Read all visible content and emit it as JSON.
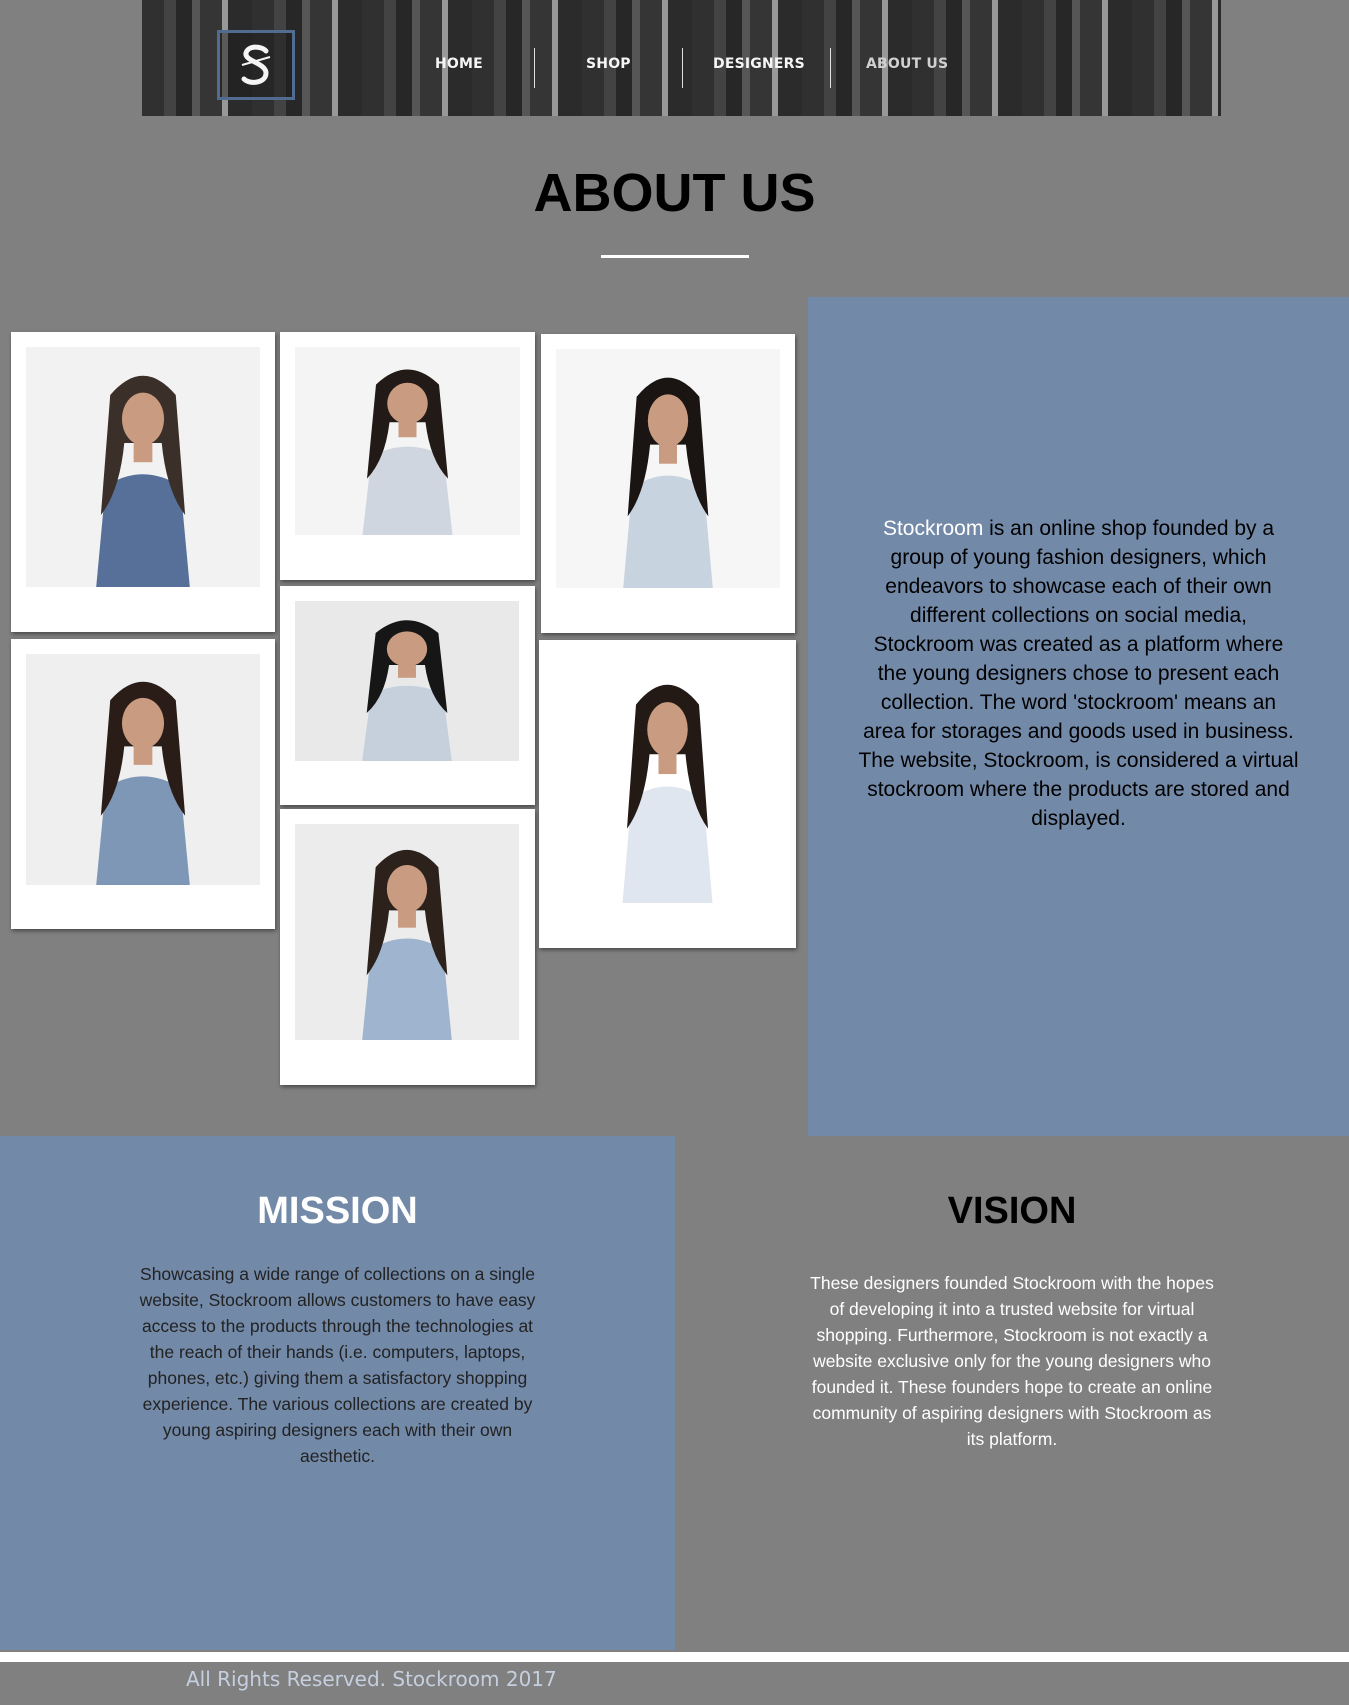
{
  "header": {
    "logo_icon": "stockroom-s-logo-icon",
    "nav": [
      "HOME",
      "SHOP",
      "DESIGNERS",
      "ABOUT US"
    ],
    "active_nav": "ABOUT US"
  },
  "page": {
    "title": "ABOUT US"
  },
  "gallery": {
    "photos": [
      {
        "name": "photo-model-denim-overalls",
        "top": "#3b2f2a",
        "cloth": "#56709a",
        "bg": "#f2f2f2"
      },
      {
        "name": "photo-model-striped-shirt",
        "top": "#221a16",
        "cloth": "#cfd6e0",
        "bg": "#f4f4f4"
      },
      {
        "name": "photo-model-light-denim-dress",
        "top": "#1a1412",
        "cloth": "#c8d3e0",
        "bg": "#f6f6f6"
      },
      {
        "name": "photo-model-blue-crop-top",
        "top": "#2a1d18",
        "cloth": "#7f97b6",
        "bg": "#efefef"
      },
      {
        "name": "photo-model-denim-jacket",
        "top": "#161616",
        "cloth": "#c5d0dc",
        "bg": "#e9e9e9"
      },
      {
        "name": "photo-model-white-sweater",
        "top": "#231a16",
        "cloth": "#dfe6f0",
        "bg": "#ffffff"
      },
      {
        "name": "photo-model-denim-tee-necklace",
        "top": "#2d211c",
        "cloth": "#9fb5cf",
        "bg": "#ececec"
      }
    ]
  },
  "about": {
    "brand": "Stockroom",
    "text": " is an online shop founded by a group of young fashion designers, which endeavors to showcase each of their own different collections on social media, Stockroom was created as a platform where the young designers chose to present each collection. The word 'stockroom' means an area for storages and goods used in business. The website, Stockroom, is considered a virtual stockroom where the products are stored and displayed."
  },
  "mission": {
    "heading": "MISSION",
    "text": "Showcasing a wide range of collections on a single website, Stockroom allows customers to have easy access to the products through the technologies at the reach of their hands (i.e. computers, laptops, phones, etc.) giving them a satisfactory shopping experience. The various collections are created by young aspiring designers each with their own aesthetic."
  },
  "vision": {
    "heading": "VISION",
    "text": "These designers founded Stockroom with the hopes of developing it into a trusted website for virtual shopping. Furthermore, Stockroom is not exactly a website exclusive only for the young designers who founded it. These founders hope to create an online community of aspiring designers with Stockroom as its platform."
  },
  "footer": {
    "text": "All Rights Reserved. Stockroom 2017"
  },
  "colors": {
    "page_bg": "#808080",
    "panel_blue": "#7389a8",
    "logo_border": "#4f6b93"
  }
}
